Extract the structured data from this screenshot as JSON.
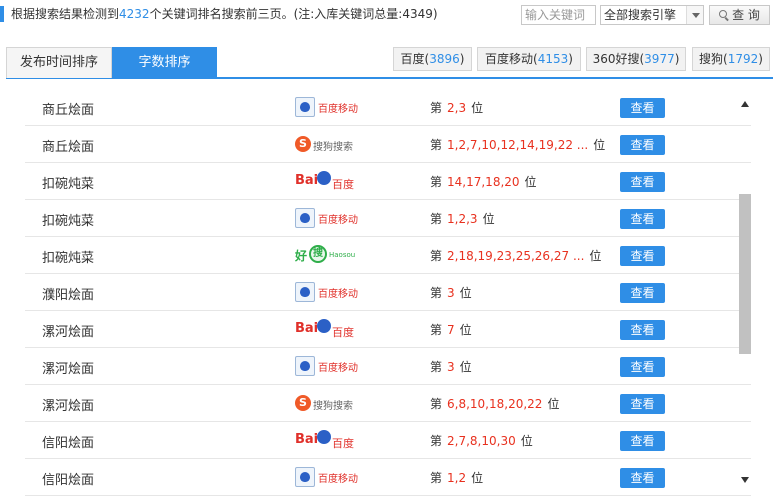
{
  "header": {
    "summary_prefix": "根据搜索结果检测到",
    "keyword_count": "4232",
    "summary_suffix": "个关键词排名搜索前三页。(注:入库关键词总量:4349)",
    "keyword_input_placeholder": "输入关键词",
    "engine_select_value": "全部搜索引擎",
    "search_button_label": "查 询"
  },
  "sort_tabs": [
    {
      "label": "发布时间排序",
      "active": false
    },
    {
      "label": "字数排序",
      "active": true
    }
  ],
  "engine_tabs": [
    {
      "name": "百度",
      "count": "3896"
    },
    {
      "name": "百度移动",
      "count": "4153"
    },
    {
      "name": "360好搜",
      "count": "3977"
    },
    {
      "name": "搜狗",
      "count": "1792"
    }
  ],
  "rows": [
    {
      "keyword": "商丘烩面",
      "engine": "baidu-mobile",
      "rank_prefix": "第",
      "positions": "2,3",
      "rank_suffix": "位",
      "button": "查看"
    },
    {
      "keyword": "商丘烩面",
      "engine": "sogou",
      "rank_prefix": "第",
      "positions": "1,2,7,10,12,14,19,22 ...",
      "rank_suffix": "位",
      "button": "查看"
    },
    {
      "keyword": "扣碗炖菜",
      "engine": "baidu",
      "rank_prefix": "第",
      "positions": "14,17,18,20",
      "rank_suffix": "位",
      "button": "查看"
    },
    {
      "keyword": "扣碗炖菜",
      "engine": "baidu-mobile",
      "rank_prefix": "第",
      "positions": "1,2,3",
      "rank_suffix": "位",
      "button": "查看"
    },
    {
      "keyword": "扣碗炖菜",
      "engine": "haosou",
      "rank_prefix": "第",
      "positions": "2,18,19,23,25,26,27 ...",
      "rank_suffix": "位",
      "button": "查看"
    },
    {
      "keyword": "濮阳烩面",
      "engine": "baidu-mobile",
      "rank_prefix": "第",
      "positions": "3",
      "rank_suffix": "位",
      "button": "查看"
    },
    {
      "keyword": "漯河烩面",
      "engine": "baidu",
      "rank_prefix": "第",
      "positions": "7",
      "rank_suffix": "位",
      "button": "查看"
    },
    {
      "keyword": "漯河烩面",
      "engine": "baidu-mobile",
      "rank_prefix": "第",
      "positions": "3",
      "rank_suffix": "位",
      "button": "查看"
    },
    {
      "keyword": "漯河烩面",
      "engine": "sogou",
      "rank_prefix": "第",
      "positions": "6,8,10,18,20,22",
      "rank_suffix": "位",
      "button": "查看"
    },
    {
      "keyword": "信阳烩面",
      "engine": "baidu",
      "rank_prefix": "第",
      "positions": "2,7,8,10,30",
      "rank_suffix": "位",
      "button": "查看"
    },
    {
      "keyword": "信阳烩面",
      "engine": "baidu-mobile",
      "rank_prefix": "第",
      "positions": "1,2",
      "rank_suffix": "位",
      "button": "查看"
    }
  ],
  "logos": {
    "baidu-mobile": {
      "text": "百度移动"
    },
    "sogou": {
      "mark": "S",
      "text": "搜狗搜索"
    },
    "baidu": {
      "bai": "Bai",
      "du": "百度"
    },
    "haosou": {
      "hao": "好",
      "sou": "搜",
      "text": "Haosou"
    }
  },
  "colors": {
    "accent": "#2f8ee6",
    "rank_highlight": "#e8311f"
  }
}
